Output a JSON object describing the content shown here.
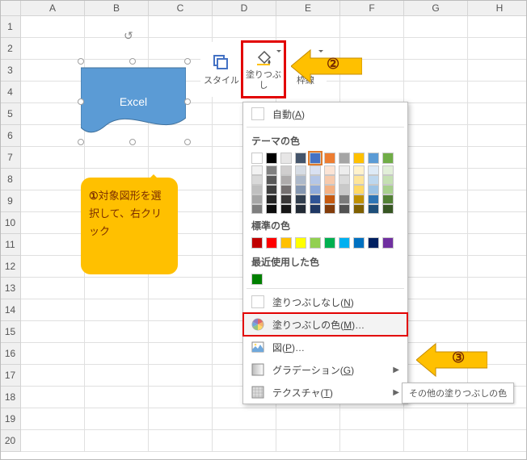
{
  "grid": {
    "cols": [
      "A",
      "B",
      "C",
      "D",
      "E",
      "F",
      "G",
      "H"
    ],
    "rows": 20
  },
  "shape": {
    "text": "Excel"
  },
  "callout1": {
    "num": "①",
    "text": "対象図形を選択して、右クリック"
  },
  "step2": {
    "num": "②"
  },
  "step3": {
    "num": "③"
  },
  "toolbar": {
    "style": "スタイル",
    "fill": "塗りつぶし",
    "border": "枠線"
  },
  "dropdown": {
    "auto": "自動(A)",
    "theme_hdr": "テーマの色",
    "theme_row1": [
      "#ffffff",
      "#000000",
      "#e7e6e6",
      "#44546a",
      "#4472c4",
      "#ed7d31",
      "#a5a5a5",
      "#ffc000",
      "#5b9bd5",
      "#70ad47"
    ],
    "theme_grad": [
      [
        "#f2f2f2",
        "#808080",
        "#d0cece",
        "#d6dce4",
        "#d9e1f2",
        "#fbe4d5",
        "#ededed",
        "#fff2cc",
        "#deeaf6",
        "#e2efd9"
      ],
      [
        "#d9d9d9",
        "#595959",
        "#aeabab",
        "#adb9ca",
        "#b4c6e7",
        "#f7caac",
        "#dbdbdb",
        "#fee599",
        "#bdd7ee",
        "#c5e0b3"
      ],
      [
        "#bfbfbf",
        "#3f3f3f",
        "#757070",
        "#8496b0",
        "#8eaadb",
        "#f4b183",
        "#c9c9c9",
        "#ffd965",
        "#9cc3e5",
        "#a8d08d"
      ],
      [
        "#a6a6a6",
        "#262626",
        "#3a3838",
        "#323f4f",
        "#2f5496",
        "#c55a11",
        "#7b7b7b",
        "#bf9000",
        "#2e75b5",
        "#538135"
      ],
      [
        "#7f7f7f",
        "#0c0c0c",
        "#171616",
        "#222a35",
        "#1f3864",
        "#833c0b",
        "#525252",
        "#7f6000",
        "#1e4e79",
        "#375623"
      ]
    ],
    "std_hdr": "標準の色",
    "std_row": [
      "#c00000",
      "#ff0000",
      "#ffc000",
      "#ffff00",
      "#92d050",
      "#00b050",
      "#00b0f0",
      "#0070c0",
      "#002060",
      "#7030a0"
    ],
    "recent_hdr": "最近使用した色",
    "recent": [
      "#008000"
    ],
    "nofill": "塗りつぶしなし(N)",
    "morefill": "塗りつぶしの色(M)…",
    "picture": "図(P)…",
    "gradient": "グラデーション(G)",
    "texture": "テクスチャ(T)"
  },
  "tooltip": "その他の塗りつぶしの色"
}
